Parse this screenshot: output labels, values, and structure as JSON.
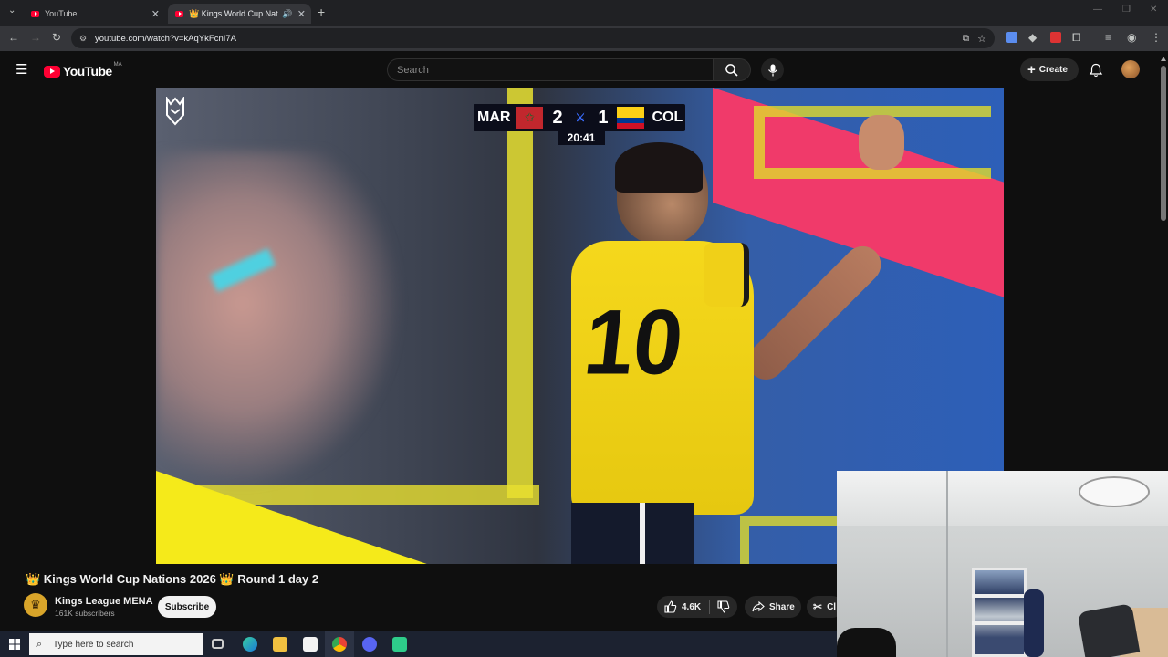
{
  "browser": {
    "tabs": [
      {
        "label": "YouTube",
        "active": false
      },
      {
        "label": "👑 Kings World Cup Natio",
        "active": true
      }
    ],
    "url": "youtube.com/watch?v=kAqYkFcnI7A"
  },
  "youtube": {
    "logo_text": "YouTube",
    "country_code": "MA",
    "search_placeholder": "Search",
    "create_label": "Create"
  },
  "scoreboard": {
    "home_team": "MAR",
    "home_score": "2",
    "away_team": "COL",
    "away_score": "1",
    "clock": "20:41",
    "jersey_number": "10"
  },
  "video": {
    "title": "👑 Kings World Cup Nations 2026 👑 Round 1 day 2",
    "channel_name": "Kings League MENA",
    "subscribers": "161K subscribers",
    "subscribe_label": "Subscribe",
    "like_count": "4.6K",
    "share_label": "Share",
    "clip_label": "Cl"
  },
  "taskbar": {
    "search_placeholder": "Type here to search"
  },
  "colors": {
    "youtube_red": "#ff0033",
    "jersey_yellow": "#f3d21a",
    "background": "#0f0f0f"
  }
}
